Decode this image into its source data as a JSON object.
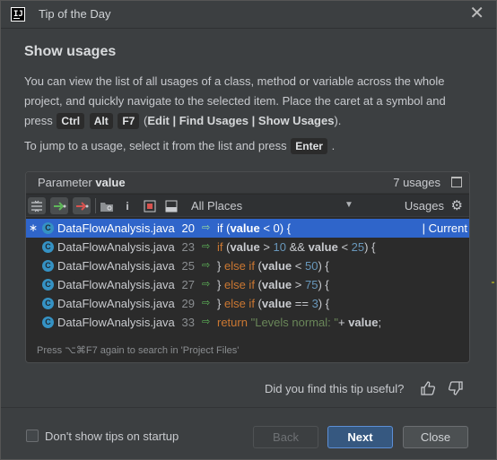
{
  "window": {
    "title": "Tip of the Day",
    "app_icon_text": "IJ"
  },
  "tip": {
    "title": "Show usages",
    "p1_a": "You can view the list of all usages of a class, method or variable across the whole project, and quickly navigate to the selected item. Place the caret at a symbol and press",
    "keys": [
      "Ctrl",
      "Alt",
      "F7"
    ],
    "p1_menu_open": "(",
    "p1_menu": "Edit | Find Usages | Show Usages",
    "p1_menu_close": ").",
    "p2_a": "To jump to a usage, select it from the list and press",
    "p2_key": "Enter",
    "p2_b": "."
  },
  "panel": {
    "title_prefix": "Parameter",
    "title_name": "value",
    "count": "7 usages",
    "scope": "All Places",
    "usages_label": "Usages",
    "footer": "Press ⌥⌘F7 again to search in 'Project Files'",
    "rows": [
      {
        "file": "DataFlowAnalysis.java",
        "line": "20",
        "selected": true,
        "current": "| Current"
      },
      {
        "file": "DataFlowAnalysis.java",
        "line": "23"
      },
      {
        "file": "DataFlowAnalysis.java",
        "line": "25"
      },
      {
        "file": "DataFlowAnalysis.java",
        "line": "27"
      },
      {
        "file": "DataFlowAnalysis.java",
        "line": "29"
      },
      {
        "file": "DataFlowAnalysis.java",
        "line": "33"
      }
    ],
    "code": {
      "r0": [
        "if (",
        "value",
        " < 0) {"
      ],
      "r1": [
        "if",
        " (",
        "value",
        " > ",
        "10",
        " && ",
        "value",
        " < ",
        "25",
        ") {"
      ],
      "r2": [
        "} ",
        "else if",
        " (",
        "value",
        " < ",
        "50",
        ") {"
      ],
      "r3": [
        "} ",
        "else if",
        " (",
        "value",
        " > ",
        "75",
        ") {"
      ],
      "r4": [
        "} ",
        "else if",
        " (",
        "value",
        " == ",
        "3",
        ") {"
      ],
      "r5": [
        "return",
        " ",
        "\"Levels normal: \"",
        "+ ",
        "value",
        ";"
      ]
    }
  },
  "feedback": {
    "question": "Did you find this tip useful?"
  },
  "footer": {
    "dont_show": "Don't show tips on startup",
    "back": "Back",
    "next": "Next",
    "close": "Close"
  },
  "icons": [
    "close-icon",
    "pin-icon",
    "expand-icon",
    "next-occurrence-icon",
    "prev-occurrence-icon",
    "open-in-tool-window-icon",
    "info-icon",
    "preview-icon",
    "filter-icon",
    "gear-icon",
    "class-icon",
    "thumbs-up-icon",
    "thumbs-down-icon"
  ],
  "colors": {
    "selection": "#2f65ca",
    "next_button": "#365880",
    "keyword": "#cc7832",
    "number": "#6897bb"
  }
}
